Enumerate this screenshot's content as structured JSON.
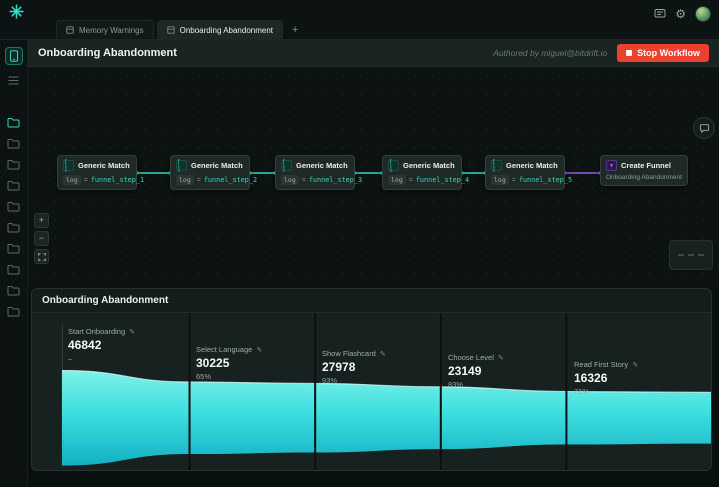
{
  "colors": {
    "accent": "#2fd9bd",
    "purple": "#8b5cf6",
    "stop_red": "#e8432e",
    "funnel_top": "#7df2ea",
    "funnel_mid": "#3cdede",
    "funnel_bottom": "#14b0c4",
    "separator": "#0a110f"
  },
  "icons": {
    "logo": "bitdrift-spark",
    "gear": "⚙",
    "plus": "+",
    "minus": "−",
    "edit": "✎",
    "match": "[ ]",
    "funnel": "▼"
  },
  "topbar": {
    "tabs": [
      {
        "label": "Memory Warnings",
        "active": false
      },
      {
        "label": "Onboarding Abandonment",
        "active": true
      }
    ],
    "new_tab_label": "+"
  },
  "sidebar": {
    "folder_count": 10
  },
  "page": {
    "title": "Onboarding Abandonment",
    "authored_by": "Authored by miguel@bitdrift.io",
    "stop_label": "Stop Workflow"
  },
  "workflow": {
    "nodes": [
      {
        "type": "match",
        "title": "Generic Match",
        "field": "log",
        "op": "=",
        "value": "funnel_step_1"
      },
      {
        "type": "match",
        "title": "Generic Match",
        "field": "log",
        "op": "=",
        "value": "funnel_step_2"
      },
      {
        "type": "match",
        "title": "Generic Match",
        "field": "log",
        "op": "=",
        "value": "funnel_step_3"
      },
      {
        "type": "match",
        "title": "Generic Match",
        "field": "log",
        "op": "=",
        "value": "funnel_step_4"
      },
      {
        "type": "match",
        "title": "Generic Match",
        "field": "log",
        "op": "=",
        "value": "funnel_step_5"
      },
      {
        "type": "create",
        "title": "Create Funnel",
        "subtitle": "Onboarding Abandonment"
      }
    ]
  },
  "funnel_panel": {
    "title": "Onboarding Abandonment",
    "stages": [
      {
        "label": "Start Onboarding",
        "value": "46842",
        "pct": "–"
      },
      {
        "label": "Select Language",
        "value": "30225",
        "pct": "65%"
      },
      {
        "label": "Show Flashcard",
        "value": "27978",
        "pct": "93%"
      },
      {
        "label": "Choose Level",
        "value": "23149",
        "pct": "83%"
      },
      {
        "label": "Read First Story",
        "value": "16326",
        "pct": "71%"
      }
    ]
  },
  "chart_data": {
    "type": "area",
    "variant": "funnel",
    "title": "Onboarding Abandonment",
    "categories": [
      "Start Onboarding",
      "Select Language",
      "Show Flashcard",
      "Choose Level",
      "Read First Story"
    ],
    "values": [
      46842,
      30225,
      27978,
      23149,
      16326
    ],
    "conversion": [
      "–",
      "65%",
      "93%",
      "83%",
      "71%"
    ],
    "legend_position": "none",
    "grid": false
  }
}
